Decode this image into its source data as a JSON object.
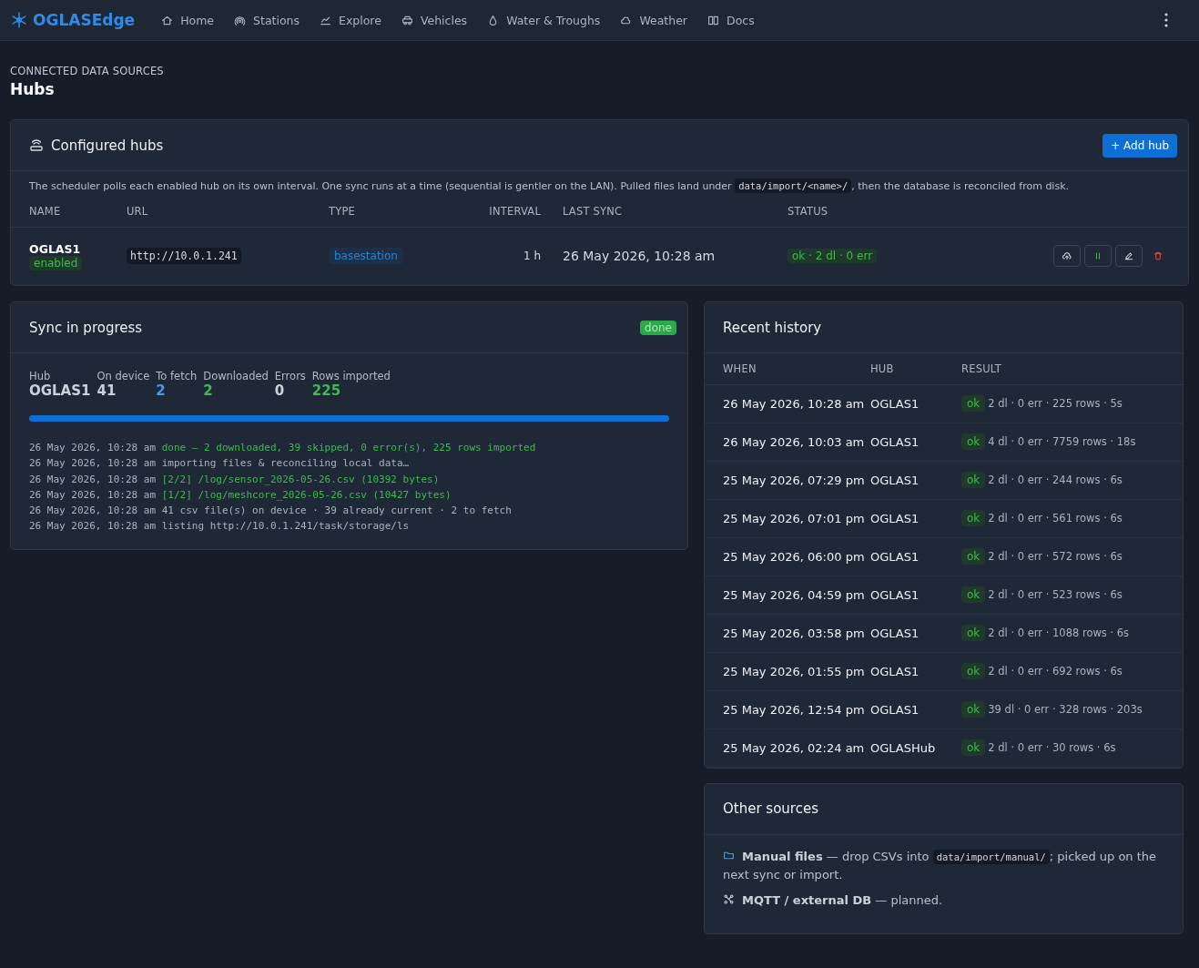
{
  "brand": "OGLASEdge",
  "nav": [
    {
      "label": "Home"
    },
    {
      "label": "Stations"
    },
    {
      "label": "Explore"
    },
    {
      "label": "Vehicles"
    },
    {
      "label": "Water & Troughs"
    },
    {
      "label": "Weather"
    },
    {
      "label": "Docs"
    }
  ],
  "page": {
    "eyebrow": "CONNECTED DATA SOURCES",
    "title": "Hubs"
  },
  "hubs": {
    "title": "Configured hubs",
    "add_button": "+ Add hub",
    "description": {
      "before": "The scheduler polls each enabled hub on its own interval. One sync runs at a time (sequential is gentler on the LAN). Pulled files land under ",
      "code": "data/import/<name>/",
      "after": ", then the database is reconciled from disk."
    },
    "columns": [
      "NAME",
      "URL",
      "TYPE",
      "INTERVAL",
      "LAST SYNC",
      "STATUS"
    ],
    "rows": [
      {
        "name": "OGLAS1",
        "enabled": true,
        "state_label": "enabled",
        "url": "http://10.0.1.241",
        "type": "basestation",
        "interval": "1 h",
        "last_sync": "26 May 2026, 10:28 am",
        "status": "ok · 2 dl · 0 err",
        "actions": [
          {
            "kind": "sync"
          },
          {
            "kind": "pause"
          },
          {
            "kind": "edit"
          },
          {
            "kind": "delete"
          }
        ]
      }
    ]
  },
  "sync": {
    "title": "Sync in progress",
    "badge": "done",
    "stats": [
      {
        "label": "Hub",
        "value": "OGLAS1",
        "color": "#c9d1d9"
      },
      {
        "label": "On device",
        "value": "41",
        "color": "#c9d1d9"
      },
      {
        "label": "To fetch",
        "value": "2",
        "color": "#4c9be8"
      },
      {
        "label": "Downloaded",
        "value": "2",
        "color": "#3fb950"
      },
      {
        "label": "Errors",
        "value": "0",
        "color": "#c9d1d9"
      },
      {
        "label": "Rows imported",
        "value": "225",
        "color": "#3fb950"
      }
    ],
    "progress": {
      "level": 1
    },
    "log": [
      {
        "time": "26 May 2026, 10:28 am",
        "text": "done — 2 downloaded, 39 skipped, 0 error(s), 225 rows imported",
        "kind": "success"
      },
      {
        "time": "26 May 2026, 10:28 am",
        "text": "importing files & reconciling local data…",
        "kind": "info"
      },
      {
        "time": "26 May 2026, 10:28 am",
        "text": "[2/2] /log/sensor_2026-05-26.csv (10392 bytes)",
        "kind": "success"
      },
      {
        "time": "26 May 2026, 10:28 am",
        "text": "[1/2] /log/meshcore_2026-05-26.csv (10427 bytes)",
        "kind": "success"
      },
      {
        "time": "26 May 2026, 10:28 am",
        "text": "41 csv file(s) on device · 39 already current · 2 to fetch",
        "kind": "info"
      },
      {
        "time": "26 May 2026, 10:28 am",
        "text": "listing http://10.0.1.241/task/storage/ls",
        "kind": "info"
      }
    ]
  },
  "history": {
    "title": "Recent history",
    "columns": [
      "WHEN",
      "HUB",
      "RESULT"
    ],
    "rows": [
      {
        "when": "26 May 2026, 10:28 am",
        "hub": "OGLAS1",
        "status": "ok",
        "result": "2 dl · 0 err · 225 rows · 5s"
      },
      {
        "when": "26 May 2026, 10:03 am",
        "hub": "OGLAS1",
        "status": "ok",
        "result": "4 dl · 0 err · 7759 rows · 18s"
      },
      {
        "when": "25 May 2026, 07:29 pm",
        "hub": "OGLAS1",
        "status": "ok",
        "result": "2 dl · 0 err · 244 rows · 6s"
      },
      {
        "when": "25 May 2026, 07:01 pm",
        "hub": "OGLAS1",
        "status": "ok",
        "result": "2 dl · 0 err · 561 rows · 6s"
      },
      {
        "when": "25 May 2026, 06:00 pm",
        "hub": "OGLAS1",
        "status": "ok",
        "result": "2 dl · 0 err · 572 rows · 6s"
      },
      {
        "when": "25 May 2026, 04:59 pm",
        "hub": "OGLAS1",
        "status": "ok",
        "result": "2 dl · 0 err · 523 rows · 6s"
      },
      {
        "when": "25 May 2026, 03:58 pm",
        "hub": "OGLAS1",
        "status": "ok",
        "result": "2 dl · 0 err · 1088 rows · 6s"
      },
      {
        "when": "25 May 2026, 01:55 pm",
        "hub": "OGLAS1",
        "status": "ok",
        "result": "2 dl · 0 err · 692 rows · 6s"
      },
      {
        "when": "25 May 2026, 12:54 pm",
        "hub": "OGLAS1",
        "status": "ok",
        "result": "39 dl · 0 err · 328 rows · 203s"
      },
      {
        "when": "25 May 2026, 02:24 am",
        "hub": "OGLASHub",
        "status": "ok",
        "result": "2 dl · 0 err · 30 rows · 6s"
      }
    ]
  },
  "other": {
    "title": "Other sources",
    "items": [
      {
        "kind": "folder",
        "before": "**Manual files** — drop CSVs into ",
        "code": "data/import/manual/",
        "after": "; picked up on the next sync or import."
      },
      {
        "kind": "network",
        "before": "**MQTT / external DB** — planned."
      }
    ]
  }
}
